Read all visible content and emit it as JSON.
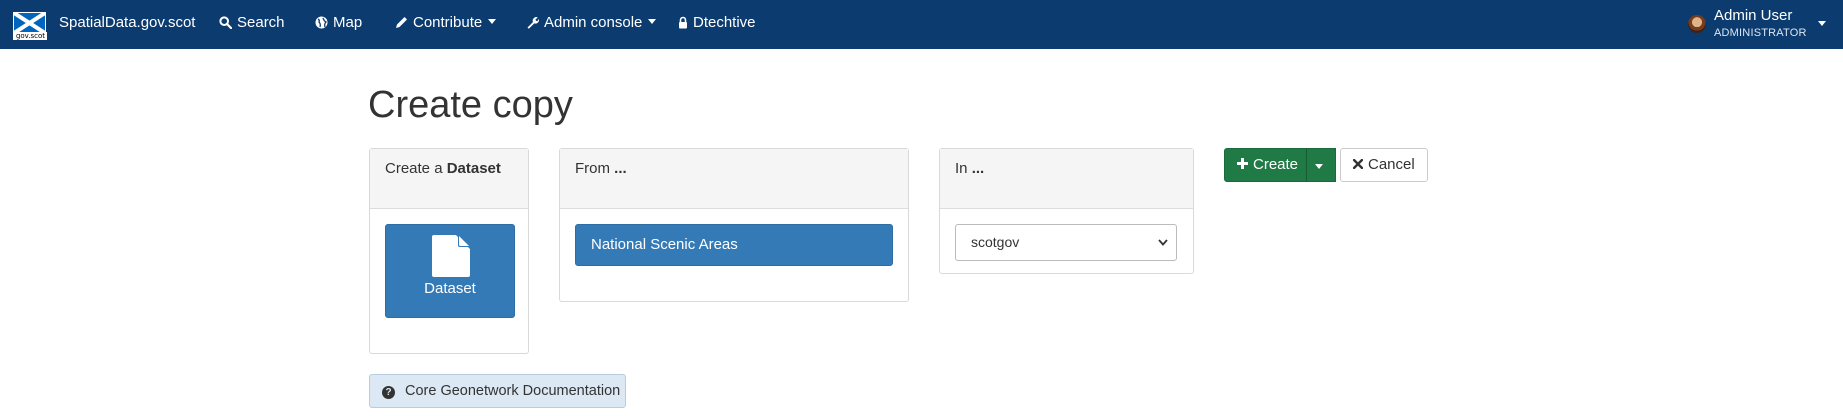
{
  "navbar": {
    "logo_text": "gov.scot",
    "brand": "SpatialData.gov.scot",
    "items": [
      {
        "label": "Search",
        "icon": "search-icon"
      },
      {
        "label": "Map",
        "icon": "globe-icon"
      },
      {
        "label": "Contribute",
        "icon": "pencil-icon",
        "dropdown": true
      },
      {
        "label": "Admin console",
        "icon": "wrench-icon",
        "dropdown": true
      },
      {
        "label": "Dtechtive",
        "icon": "lock-icon"
      }
    ],
    "user": {
      "name": "Admin User",
      "role": "ADMINISTRATOR"
    },
    "background_color": "#0b3b6f"
  },
  "page": {
    "title": "Create copy"
  },
  "type_panel": {
    "heading_prefix": "Create a ",
    "heading_bold": "Dataset",
    "type_button_label": "Dataset"
  },
  "source_panel": {
    "heading_prefix": "From ",
    "heading_bold": "...",
    "selected_source": "National Scenic Areas"
  },
  "group_panel": {
    "heading_prefix": "In ",
    "heading_bold": "...",
    "selected_group": "scotgov"
  },
  "actions": {
    "create_label": "Create",
    "cancel_label": "Cancel"
  },
  "footer": {
    "doc_link_label": "Core Geonetwork Documentation"
  },
  "colors": {
    "primary": "#337ab7",
    "success": "#1f7a45",
    "navbar": "#0b3b6f"
  }
}
